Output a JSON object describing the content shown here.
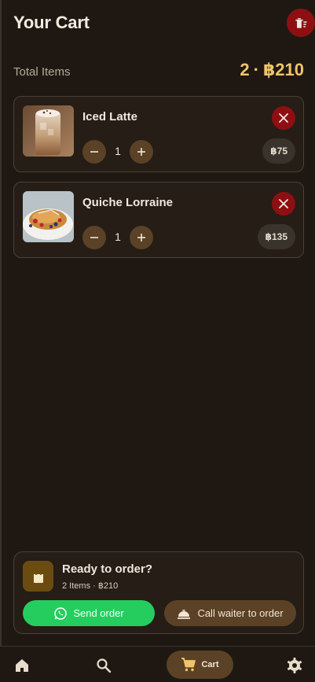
{
  "header": {
    "title": "Your Cart"
  },
  "summary": {
    "label": "Total Items",
    "count": "2",
    "separator": "·",
    "total": "฿210"
  },
  "items": [
    {
      "name": "Iced Latte",
      "quantity": "1",
      "price": "฿75",
      "image_icon": "iced-latte-photo"
    },
    {
      "name": "Quiche Lorraine",
      "quantity": "1",
      "price": "฿135",
      "image_icon": "quiche-photo"
    }
  ],
  "order_panel": {
    "title": "Ready to order?",
    "subtitle": "2 Items · ฿210",
    "send_label": "Send order",
    "waiter_label": "Call waiter to order"
  },
  "nav": {
    "cart_label": "Cart"
  },
  "colors": {
    "background": "#1f1812",
    "accent_gold": "#f0c46b",
    "danger": "#8e0f12",
    "whatsapp_green": "#25cd5f",
    "brown_button": "#5b4126"
  }
}
